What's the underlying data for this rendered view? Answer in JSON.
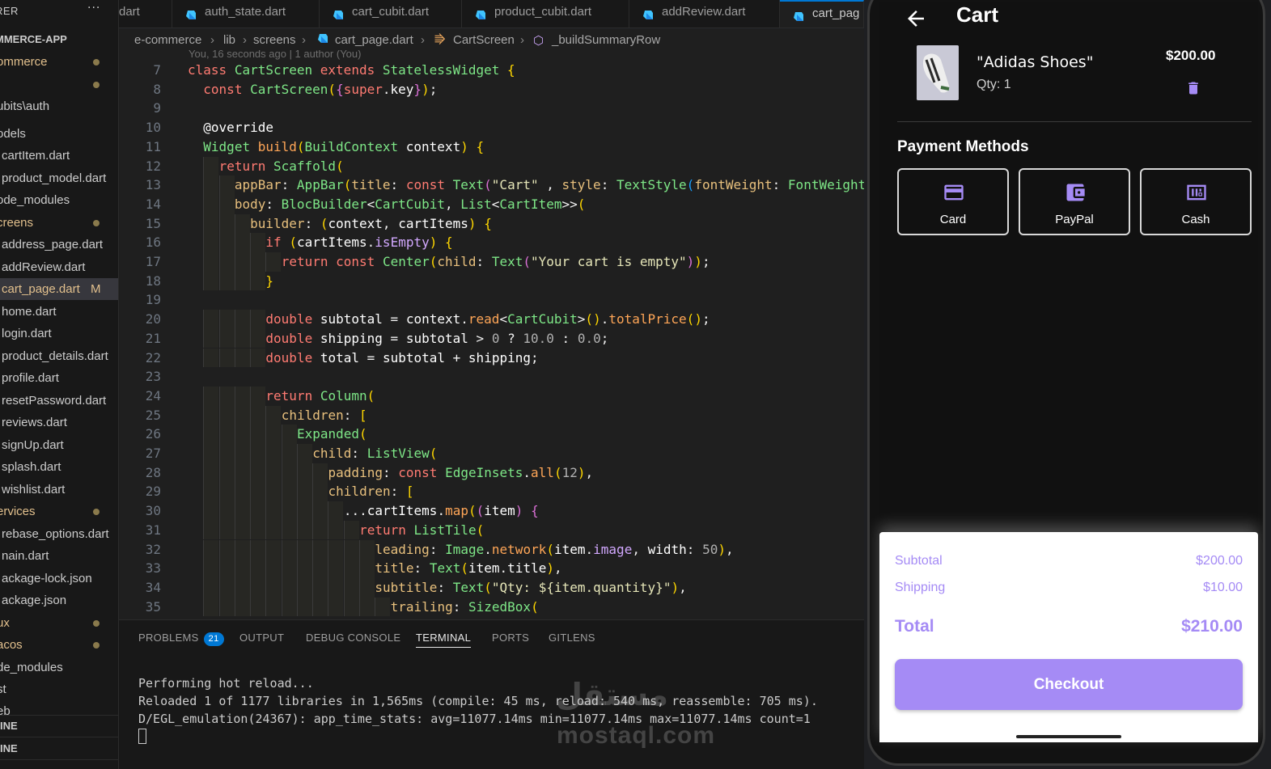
{
  "explorer": {
    "title": "RER",
    "more": "···",
    "root": "MMERCE-APP",
    "items": [
      {
        "label": "ommerce",
        "state": "dot",
        "kind": "folder"
      },
      {
        "label": "",
        "state": "dot",
        "kind": "folder"
      },
      {
        "label": "ubits\\auth",
        "state": "",
        "kind": "folder"
      },
      {
        "label": "odels",
        "state": "",
        "kind": "folder"
      },
      {
        "label": "cartItem.dart",
        "state": "",
        "kind": "file"
      },
      {
        "label": "product_model.dart",
        "state": "",
        "kind": "file"
      },
      {
        "label": "ode_modules",
        "state": "",
        "kind": "folder"
      },
      {
        "label": "creens",
        "state": "dot",
        "kind": "folder"
      },
      {
        "label": "address_page.dart",
        "state": "",
        "kind": "file"
      },
      {
        "label": "addReview.dart",
        "state": "",
        "kind": "file"
      },
      {
        "label": "cart_page.dart",
        "state": "M",
        "kind": "file"
      },
      {
        "label": "home.dart",
        "state": "",
        "kind": "file"
      },
      {
        "label": "login.dart",
        "state": "",
        "kind": "file"
      },
      {
        "label": "product_details.dart",
        "state": "",
        "kind": "file"
      },
      {
        "label": "profile.dart",
        "state": "",
        "kind": "file"
      },
      {
        "label": "resetPassword.dart",
        "state": "",
        "kind": "file"
      },
      {
        "label": "reviews.dart",
        "state": "",
        "kind": "file"
      },
      {
        "label": "signUp.dart",
        "state": "",
        "kind": "file"
      },
      {
        "label": "splash.dart",
        "state": "",
        "kind": "file"
      },
      {
        "label": "wishlist.dart",
        "state": "",
        "kind": "file"
      },
      {
        "label": "ervices",
        "state": "dot",
        "kind": "folder"
      },
      {
        "label": "rebase_options.dart",
        "state": "",
        "kind": "file"
      },
      {
        "label": "nain.dart",
        "state": "",
        "kind": "file"
      },
      {
        "label": "ackage-lock.json",
        "state": "",
        "kind": "file"
      },
      {
        "label": "ackage.json",
        "state": "",
        "kind": "file"
      },
      {
        "label": "ux",
        "state": "dot",
        "kind": "folder"
      },
      {
        "label": "acos",
        "state": "dot",
        "kind": "folder"
      },
      {
        "label": "de_modules",
        "state": "",
        "kind": "folder"
      },
      {
        "label": "st",
        "state": "",
        "kind": "folder"
      },
      {
        "label": "eb",
        "state": "",
        "kind": "folder"
      }
    ],
    "sections": [
      "INE",
      "INE"
    ]
  },
  "tabs": [
    {
      "label": "dart",
      "active": false,
      "icon": "dart-icon"
    },
    {
      "label": "auth_state.dart",
      "active": false,
      "icon": "dart-icon"
    },
    {
      "label": "cart_cubit.dart",
      "active": false,
      "icon": "dart-icon"
    },
    {
      "label": "product_cubit.dart",
      "active": false,
      "icon": "dart-icon"
    },
    {
      "label": "addReview.dart",
      "active": false,
      "icon": "dart-icon"
    },
    {
      "label": "cart_pag",
      "active": true,
      "icon": "dart-icon"
    }
  ],
  "breadcrumb": [
    "e-commerce",
    "lib",
    "screens",
    "cart_page.dart",
    "CartScreen",
    "_buildSummaryRow"
  ],
  "editor": {
    "blame": "You, 16 seconds ago | 1 author (You)",
    "line_numbers": [
      "7",
      "8",
      "9",
      "10",
      "11",
      "12",
      "13",
      "14",
      "15",
      "16",
      "17",
      "18",
      "19",
      "20",
      "21",
      "22",
      "23",
      "24",
      "25",
      "26",
      "27",
      "28",
      "29",
      "30",
      "31",
      "32",
      "33",
      "34",
      "35"
    ],
    "lines": [
      "class CartScreen extends StatelessWidget {",
      "  const CartScreen({super.key});",
      "",
      "  @override",
      "  Widget build(BuildContext context) {",
      "    return Scaffold(",
      "      appBar: AppBar(title: const Text(\"Cart\" , style: TextStyle(fontWeight: FontWeight",
      "      body: BlocBuilder<CartCubit, List<CartItem>>(",
      "        builder: (context, cartItems) {",
      "          if (cartItems.isEmpty) {",
      "            return const Center(child: Text(\"Your cart is empty\"));",
      "          }",
      "",
      "          double subtotal = context.read<CartCubit>().totalPrice();",
      "          double shipping = subtotal > 0 ? 10.0 : 0.0;",
      "          double total = subtotal + shipping;",
      "",
      "          return Column(",
      "            children: [",
      "              Expanded(",
      "                child: ListView(",
      "                  padding: const EdgeInsets.all(12),",
      "                  children: [",
      "                    ...cartItems.map((item) {",
      "                      return ListTile(",
      "                        leading: Image.network(item.image, width: 50),",
      "                        title: Text(item.title),",
      "                        subtitle: Text(\"Qty: ${item.quantity}\"),",
      "                          trailing: SizedBox("
    ]
  },
  "panel": {
    "tabs": [
      {
        "label": "PROBLEMS",
        "badge": "21",
        "active": false
      },
      {
        "label": "OUTPUT",
        "badge": "",
        "active": false
      },
      {
        "label": "DEBUG CONSOLE",
        "badge": "",
        "active": false
      },
      {
        "label": "TERMINAL",
        "badge": "",
        "active": true
      },
      {
        "label": "PORTS",
        "badge": "",
        "active": false
      },
      {
        "label": "GITLENS",
        "badge": "",
        "active": false
      }
    ],
    "terminal": [
      "Performing hot reload...",
      "Reloaded 1 of 1177 libraries in 1,565ms (compile: 45 ms, reload: 540 ms, reassemble: 705 ms).",
      "D/EGL_emulation(24367): app_time_stats: avg=11077.14ms min=11077.14ms max=11077.14ms count=1"
    ]
  },
  "watermark": {
    "arabic": "مستقل",
    "latin": "mostaql.com"
  },
  "app": {
    "title": "Cart",
    "back_icon": "arrow-left-icon",
    "item": {
      "name": "\"Adidas Shoes\"",
      "qty": "Qty: 1",
      "price": "$200.00",
      "delete_icon": "trash-icon"
    },
    "payment_title": "Payment Methods",
    "payment_methods": [
      {
        "label": "Card",
        "icon": "credit-card-icon"
      },
      {
        "label": "PayPal",
        "icon": "wallet-icon"
      },
      {
        "label": "Cash",
        "icon": "cash-icon"
      }
    ],
    "summary": {
      "subtotal_label": "Subtotal",
      "subtotal": "$200.00",
      "shipping_label": "Shipping",
      "shipping": "$10.00",
      "total_label": "Total",
      "total": "$210.00"
    },
    "checkout_label": "Checkout",
    "accent_color": "#a58bf5"
  }
}
